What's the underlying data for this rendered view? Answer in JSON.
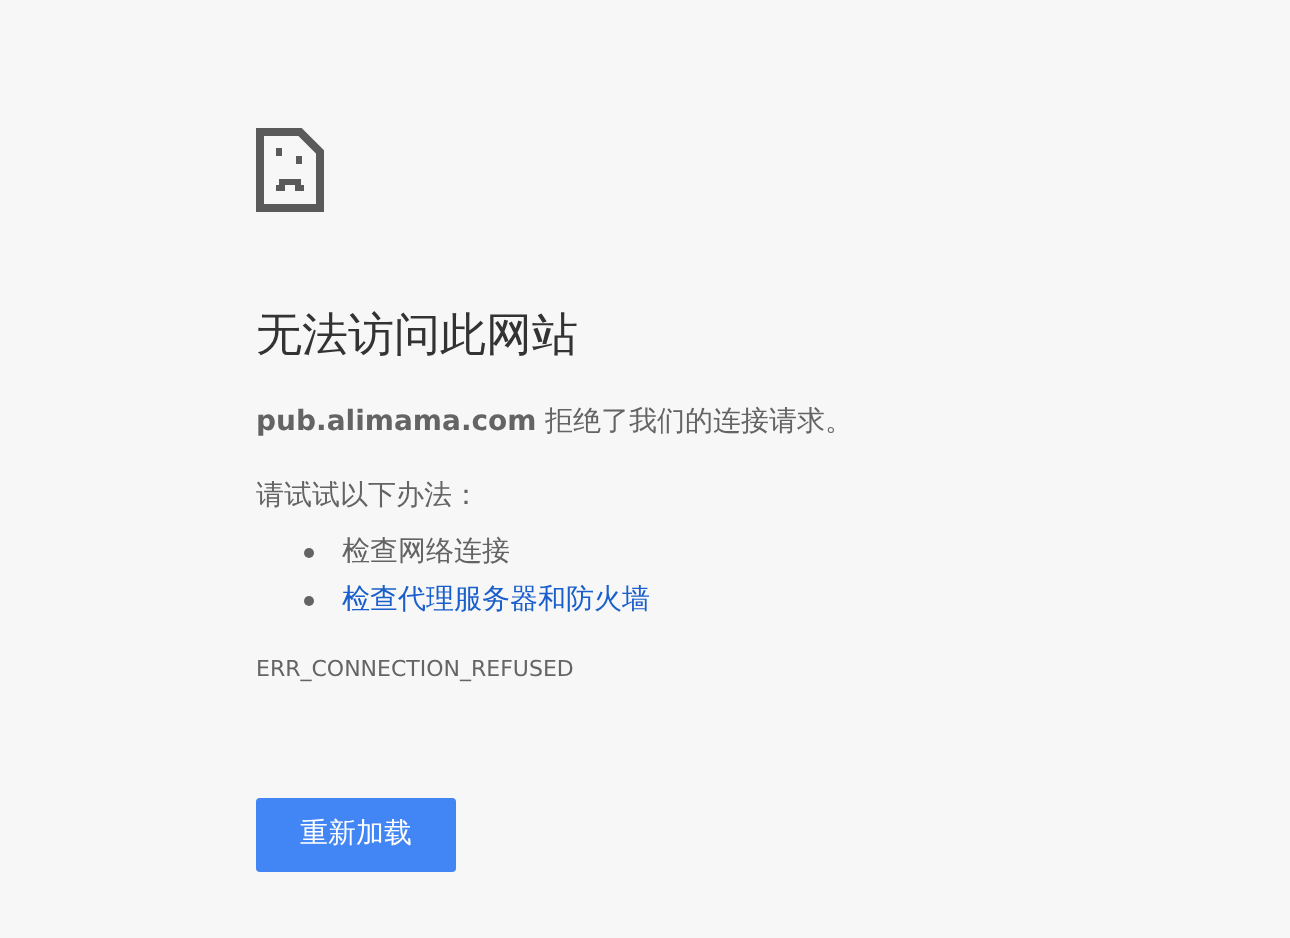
{
  "heading": "无法访问此网站",
  "message": "**pub.alimama.com** 拒绝了我们的连接请求。",
  "suggestions_intro": "请试试以下办法：",
  "suggestions": [
    {
      "text": "检查网络连接",
      "kind": "text"
    },
    {
      "text": "检查代理服务器和防火墙",
      "kind": "link"
    }
  ],
  "error_code": "ERR_CONNECTION_REFUSED",
  "reload_button": "重新加载"
}
